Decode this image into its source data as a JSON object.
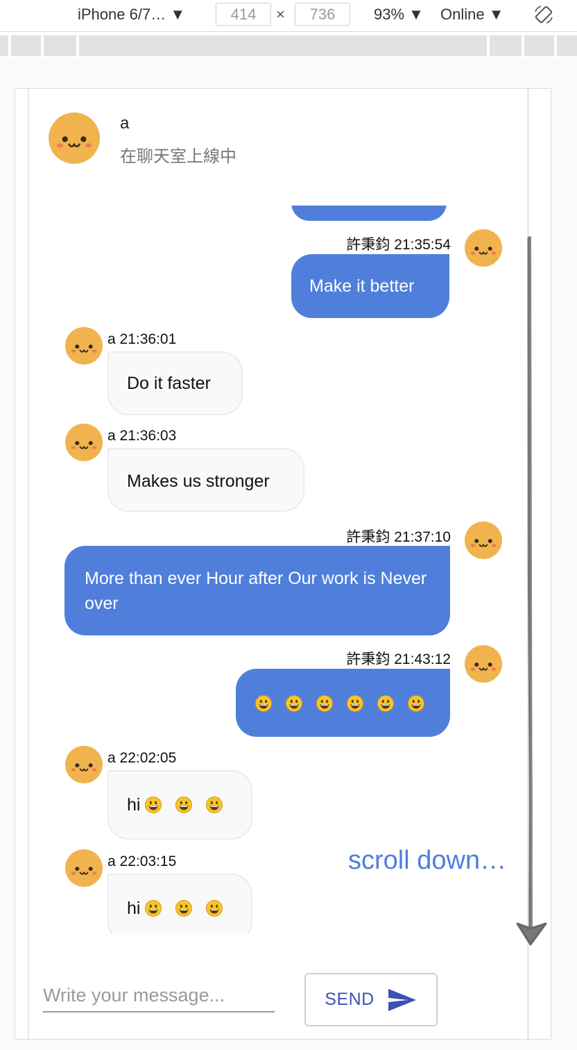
{
  "devtools": {
    "device": "iPhone 6/7…",
    "width": "414",
    "height": "736",
    "zoom": "93%",
    "network": "Online"
  },
  "header": {
    "name": "a",
    "status": "在聊天室上線中"
  },
  "messages": [
    {
      "side": "out",
      "meta": "許秉鈞 21:35:54",
      "text": "Make it better"
    },
    {
      "side": "in",
      "meta": "a 21:36:01",
      "text": "Do it faster"
    },
    {
      "side": "in",
      "meta": "a 21:36:03",
      "text": "Makes us stronger"
    },
    {
      "side": "out",
      "meta": "許秉鈞 21:37:10",
      "text": "More than ever Hour after Our work is Never over"
    },
    {
      "side": "out",
      "meta": "許秉鈞 21:43:12",
      "text": "",
      "emoji_count": 6
    },
    {
      "side": "in",
      "meta": "a 22:02:05",
      "text": "hi",
      "emoji_count": 3
    },
    {
      "side": "in",
      "meta": "a 22:03:15",
      "text": "hi",
      "emoji_count": 3
    }
  ],
  "annotation": {
    "scroll_text": "scroll down…"
  },
  "composer": {
    "placeholder": "Write your message...",
    "send_label": "SEND"
  },
  "colors": {
    "accent": "#4f7fdb",
    "send": "#3f51b5",
    "avatar": "#f0b34e"
  },
  "icons": [
    "smiley-avatar-icon",
    "grinning-emoji-icon",
    "send-arrow-icon",
    "rotate-icon",
    "dropdown-caret-icon"
  ]
}
